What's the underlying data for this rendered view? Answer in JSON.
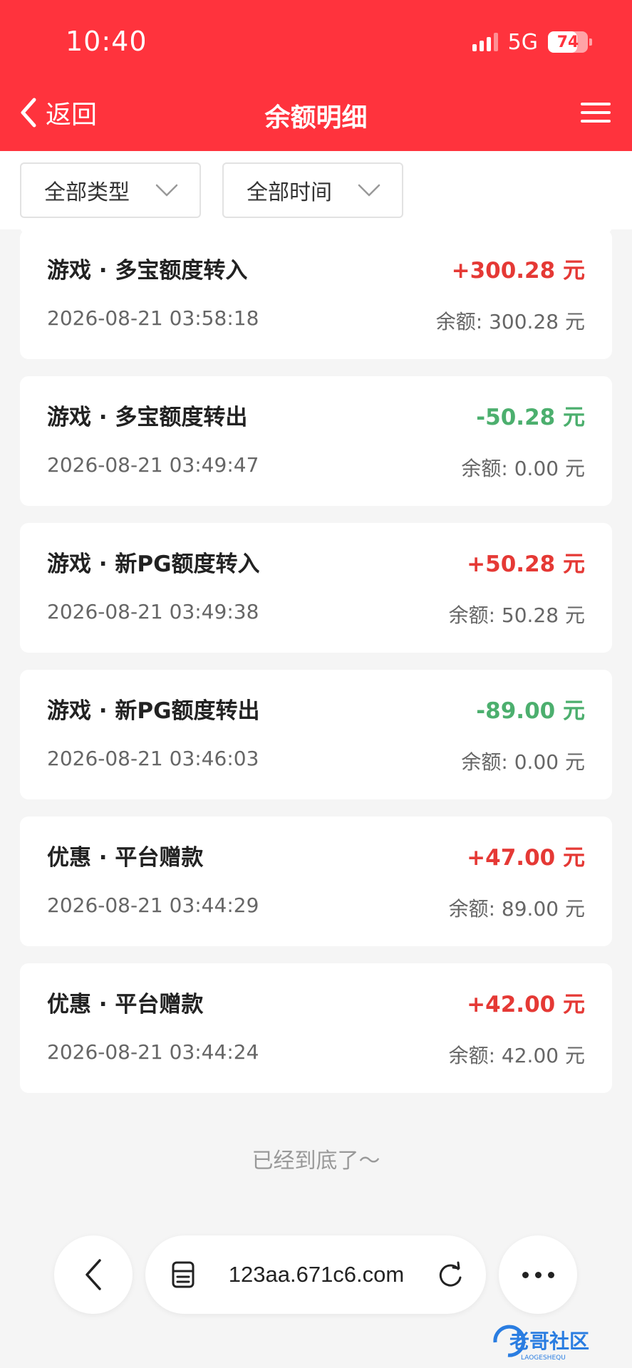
{
  "status_bar": {
    "time": "10:40",
    "network": "5G",
    "battery": "74",
    "battery_level": 0.74
  },
  "nav": {
    "back_label": "返回",
    "title": "余额明细"
  },
  "filters": {
    "type_label": "全部类型",
    "time_label": "全部时间"
  },
  "records": [
    {
      "title": "游戏 · 多宝额度转入",
      "amount": "+300.28 元",
      "sign": "pos",
      "time": "2026-08-21 03:58:18",
      "balance": "余额: 300.28 元"
    },
    {
      "title": "游戏 · 多宝额度转出",
      "amount": "-50.28 元",
      "sign": "neg",
      "time": "2026-08-21 03:49:47",
      "balance": "余额: 0.00 元"
    },
    {
      "title": "游戏 · 新PG额度转入",
      "amount": "+50.28 元",
      "sign": "pos",
      "time": "2026-08-21 03:49:38",
      "balance": "余额: 50.28 元"
    },
    {
      "title": "游戏 · 新PG额度转出",
      "amount": "-89.00 元",
      "sign": "neg",
      "time": "2026-08-21 03:46:03",
      "balance": "余额: 0.00 元"
    },
    {
      "title": "优惠 · 平台赠款",
      "amount": "+47.00 元",
      "sign": "pos",
      "time": "2026-08-21 03:44:29",
      "balance": "余额: 89.00 元"
    },
    {
      "title": "优惠 · 平台赠款",
      "amount": "+42.00 元",
      "sign": "pos",
      "time": "2026-08-21 03:44:24",
      "balance": "余额: 42.00 元"
    }
  ],
  "end_text": "已经到底了～",
  "browser": {
    "url": "123aa.671c6.com"
  },
  "watermark": {
    "text": "老哥社区",
    "subtext": "LAOGESHEQU"
  },
  "colors": {
    "header": "#ff333d",
    "positive": "#e53935",
    "negative": "#4caf6e"
  }
}
